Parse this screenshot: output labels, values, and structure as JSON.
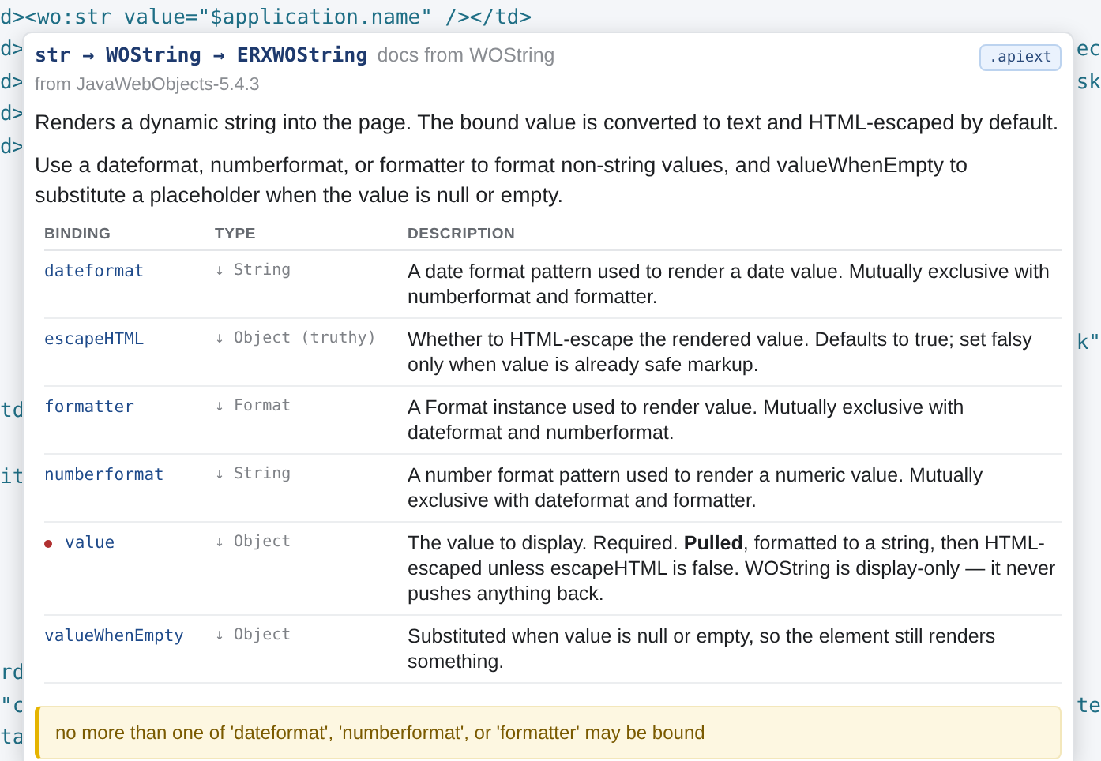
{
  "editor": {
    "top_lines": [
      {
        "left": "d><wo:str value=\"$application.name\" /></td>"
      },
      {
        "left": "d>",
        "right": "ec"
      },
      {
        "left": "d>",
        "right": "sk"
      },
      {
        "left": "d>"
      },
      {
        "left": "d>"
      }
    ],
    "middle_lines": [
      {
        "right": "k\""
      },
      {
        "left": "td"
      },
      {
        "left": "it"
      }
    ],
    "bottom_lines": [
      {
        "left": "rd"
      },
      {
        "left": "\"c",
        "right": "te"
      },
      {
        "left": "ta"
      }
    ]
  },
  "popup": {
    "title": "str → WOString → ERXWOString",
    "source": "docs from WOString",
    "badge": ".apiext",
    "origin": "from JavaWebObjects-5.4.3",
    "paragraphs": [
      "Renders a dynamic string into the page. The bound value is converted to text and HTML-escaped by default.",
      "Use a dateformat, numberformat, or formatter to format non-string values, and valueWhenEmpty to substitute a placeholder when the value is null or empty."
    ],
    "columns": [
      "BINDING",
      "TYPE",
      "DESCRIPTION"
    ],
    "rows": [
      {
        "binding": "dateformat",
        "required": false,
        "type": "↓ String",
        "description": "A date format pattern used to render a date value. Mutually exclusive with numberformat and formatter."
      },
      {
        "binding": "escapeHTML",
        "required": false,
        "type": "↓ Object (truthy)",
        "description": "Whether to HTML-escape the rendered value. Defaults to true; set falsy only when value is already safe markup."
      },
      {
        "binding": "formatter",
        "required": false,
        "type": "↓ Format",
        "description": "A Format instance used to render value. Mutually exclusive with dateformat and numberformat."
      },
      {
        "binding": "numberformat",
        "required": false,
        "type": "↓ String",
        "description": "A number format pattern used to render a numeric value. Mutually exclusive with dateformat and formatter."
      },
      {
        "binding": "value",
        "required": true,
        "type": "↓ Object",
        "description": "The value to display. Required. **Pulled**, formatted to a string, then HTML-escaped unless escapeHTML is false. WOString is display-only — it never pushes anything back."
      },
      {
        "binding": "valueWhenEmpty",
        "required": false,
        "type": "↓ Object",
        "description": "Substituted when value is null or empty, so the element still renders something."
      }
    ],
    "warning": "no more than one of 'dateformat', 'numberformat', or 'formatter' may be bound"
  }
}
